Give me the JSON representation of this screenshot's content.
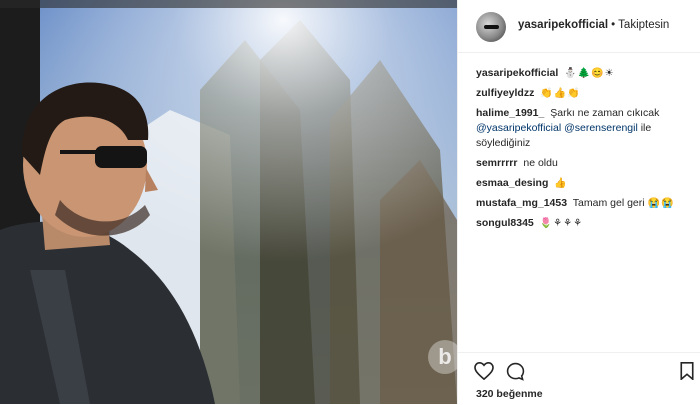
{
  "post": {
    "image_alt": "man in sunglasses looking out cable car window at snowy forest"
  },
  "header": {
    "username": "yasaripekofficial",
    "separator": "•",
    "follow_status": "Takiptesin"
  },
  "comments": [
    {
      "user": "yasaripekofficial",
      "text": "",
      "emoji": "⛄🌲😊☀"
    },
    {
      "user": "zulfiyeyldzz",
      "text": "",
      "emoji": "👏👍👏"
    },
    {
      "user": "halime_1991_",
      "text": "Şarkı ne zaman cıkıcak ",
      "mention1": "@yasaripekofficial",
      "mention2": "@serenserengil",
      "text2": " ile söylediğiniz"
    },
    {
      "user": "semrrrrr",
      "text": "ne oldu",
      "emoji": ""
    },
    {
      "user": "esmaa_desing",
      "text": "",
      "emoji": "👍"
    },
    {
      "user": "mustafa_mg_1453",
      "text": "Tamam gel geri ",
      "emoji": "😭😭"
    },
    {
      "user": "songul8345",
      "text": "",
      "emoji": "🌷⚘⚘⚘"
    }
  ],
  "actions": {
    "likes": "320 beğenme"
  },
  "icons": {
    "heart": "heart-icon",
    "comment": "comment-icon",
    "bookmark": "bookmark-icon"
  }
}
